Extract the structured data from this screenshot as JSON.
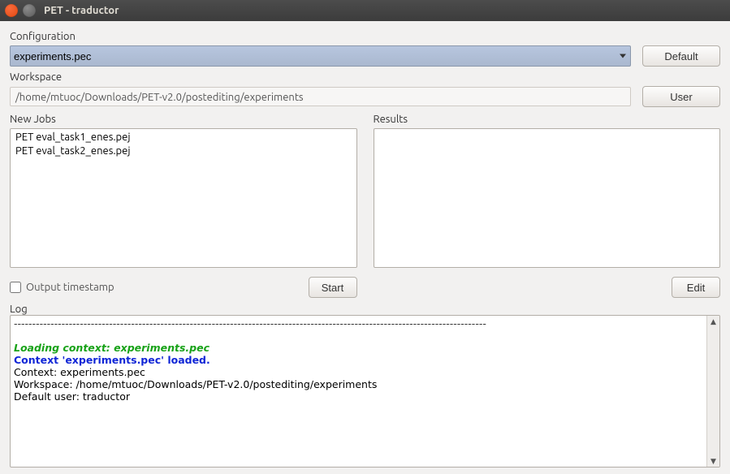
{
  "window": {
    "title": "PET - traductor"
  },
  "configuration": {
    "label": "Configuration",
    "selected": "experiments.pec",
    "default_btn": "Default"
  },
  "workspace": {
    "label": "Workspace",
    "path": "/home/mtuoc/Downloads/PET-v2.0/postediting/experiments",
    "user_btn": "User"
  },
  "jobs": {
    "label": "New Jobs",
    "items": [
      "PET eval_task1_enes.pej",
      "PET eval_task2_enes.pej"
    ],
    "output_timestamp_label": "Output timestamp",
    "start_btn": "Start"
  },
  "results": {
    "label": "Results",
    "items": [],
    "edit_btn": "Edit"
  },
  "log": {
    "label": "Log",
    "separator": "---------------------------------------------------------------------------------------------------------------------------------",
    "line_loading": "Loading context: experiments.pec",
    "line_loaded": "Context 'experiments.pec' loaded.",
    "line_context": "Context: experiments.pec",
    "line_workspace": "Workspace: /home/mtuoc/Downloads/PET-v2.0/postediting/experiments",
    "line_user": "Default user: traductor"
  }
}
